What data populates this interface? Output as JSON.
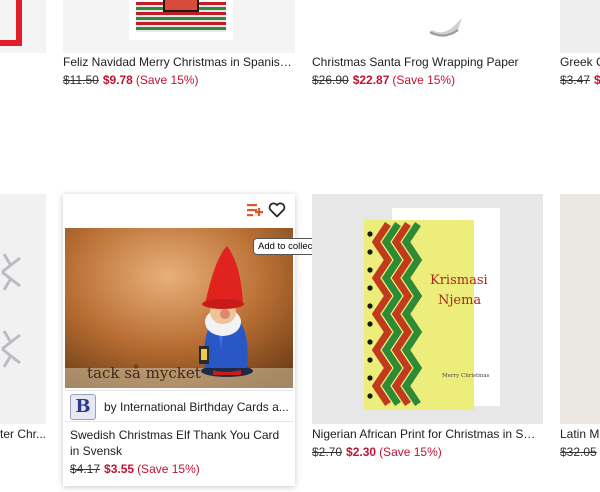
{
  "row1": [
    {
      "title": "",
      "original": "",
      "sale": "",
      "save": ""
    },
    {
      "title": "Feliz Navidad Merry Christmas in Spanish...",
      "original": "$11.50",
      "sale": "$9.78",
      "save": "(Save 15%)"
    },
    {
      "title": "Christmas Santa Frog Wrapping Paper",
      "original": "$26.90",
      "sale": "$22.87",
      "save": "(Save 15%)"
    },
    {
      "title": "Greek C",
      "original": "$3.47",
      "sale": "$",
      "save": ""
    }
  ],
  "row2": [
    {
      "title": "ter Chr...",
      "original": "",
      "sale": "",
      "save": ""
    },
    {
      "title": "Swedish Christmas Elf Thank You Card in Svensk",
      "original": "$4.17",
      "sale": "$3.55",
      "save": "(Save 15%)",
      "seller_initial": "B",
      "seller": "by International Birthday Cards a...",
      "image_caption": "tack så mycket"
    },
    {
      "title": "Nigerian African Print for Christmas in Sw...",
      "original": "$2.70",
      "sale": "$2.30",
      "save": "(Save 15%)",
      "card_text_1": "Krismasi",
      "card_text_2": "Njema",
      "card_small": "Merry Christmas"
    },
    {
      "title": "Latin Me",
      "original": "$32.05",
      "sale": "",
      "save": ""
    }
  ],
  "tooltip": "Add to collection",
  "icons": {
    "collection": "add-to-collection-icon",
    "favorite": "heart-icon"
  },
  "colors": {
    "sale": "#c01434",
    "border": "#e5e5e5"
  }
}
